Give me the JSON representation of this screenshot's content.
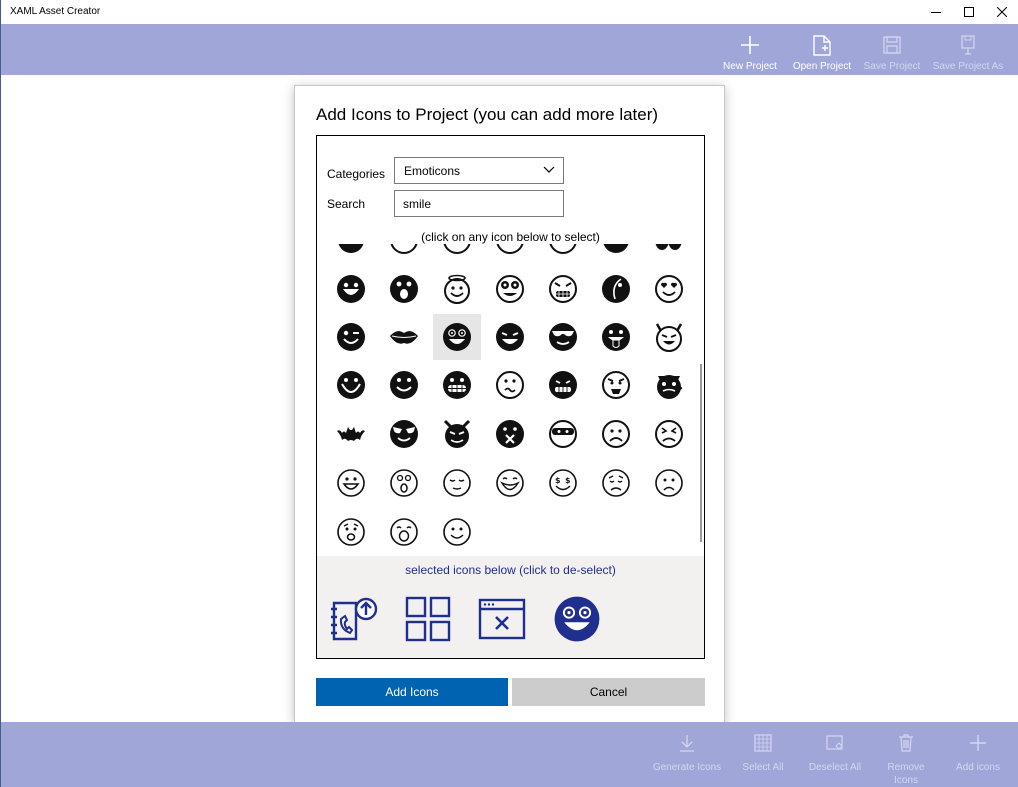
{
  "window": {
    "title": "XAML Asset Creator"
  },
  "toolbar": {
    "new_project": "New Project",
    "open_project": "Open Project",
    "save_project": "Save Project",
    "save_project_as": "Save Project As"
  },
  "bottom_toolbar": {
    "generate_icons": "Generate Icons",
    "select_all": "Select All",
    "deselect_all": "Deselect All",
    "remove_icons_line1": "Remove",
    "remove_icons_line2": "Icons",
    "add_icons": "Add icons"
  },
  "dialog": {
    "title": "Add Icons to Project (you can add more later)",
    "categories_label": "Categories",
    "categories_value": "Emoticons",
    "search_label": "Search",
    "search_value": "smile",
    "grid_hint": "(click on any icon below to select)",
    "selected_hint": "selected icons below (click to de-select)",
    "add_button": "Add Icons",
    "cancel_button": "Cancel"
  },
  "colors": {
    "bar": "#a1a6d8",
    "accent": "#0063b1",
    "selected_icon": "#1f2f8f"
  },
  "icons": {
    "grid_rows": [
      [
        "smile-open-icon",
        "surprised-icon",
        "angel-icon",
        "nerd-icon",
        "evil-grin-icon",
        "moon-face-icon",
        "heart-eyes-icon"
      ],
      [
        "wink-icon",
        "lips-icon",
        "dizzy-grin-icon",
        "squint-grin-icon",
        "sunglasses-icon",
        "tongue-out-icon",
        "devil-icon"
      ],
      [
        "big-smile-icon",
        "smile-icon",
        "grimace-icon",
        "confused-icon",
        "gritted-teeth-icon",
        "angry-tongue-icon",
        "hipster-icon"
      ],
      [
        "bat-icon",
        "cool-wink-icon",
        "cat-devil-icon",
        "kiss-icon",
        "ninja-icon",
        "frown-icon",
        "annoyed-icon"
      ],
      [
        "laugh-outline-icon",
        "shocked-outline-icon",
        "sleepy-outline-icon",
        "grin-outline-icon",
        "money-eyes-icon",
        "sad-brow-icon",
        "sad-outline-icon"
      ],
      [
        "worried-outline-icon",
        "open-mouth-outline-icon",
        "smile-outline-icon"
      ]
    ],
    "selected": [
      "contact-upload-icon",
      "app-grid-icon",
      "window-close-icon",
      "dizzy-grin-icon"
    ]
  }
}
